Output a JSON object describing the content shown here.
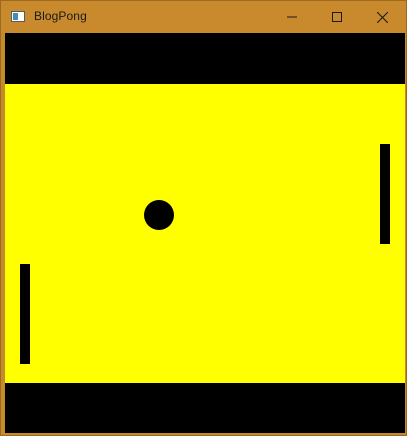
{
  "window": {
    "title": "BlogPong",
    "titlebar_color": "#c98a2d"
  },
  "controls": {
    "minimize_icon": "minimize-icon",
    "maximize_icon": "maximize-icon",
    "close_icon": "close-icon"
  },
  "game": {
    "background_color": "#000000",
    "court_color": "#ffff00",
    "paddle_color": "#000000",
    "ball_color": "#000000"
  }
}
